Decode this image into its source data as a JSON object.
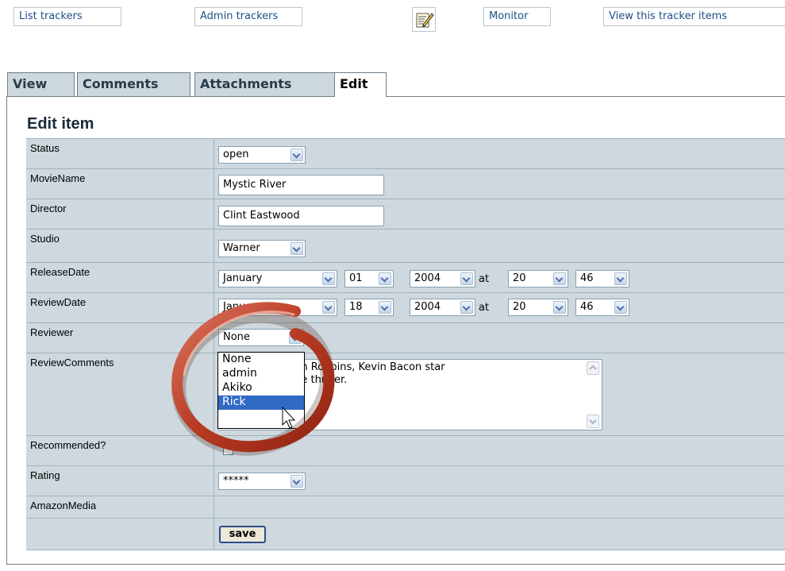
{
  "top_links": {
    "list_trackers": "List trackers",
    "admin_trackers": "Admin trackers",
    "monitor": "Monitor",
    "view_items": "View this tracker items"
  },
  "tabs": [
    "View",
    "Comments",
    "Attachments",
    "Edit"
  ],
  "active_tab": "Edit",
  "heading": "Edit item",
  "fields": {
    "status": {
      "label": "Status",
      "value": "open"
    },
    "movie_name": {
      "label": "MovieName",
      "value": "Mystic River"
    },
    "director": {
      "label": "Director",
      "value": "Clint Eastwood"
    },
    "studio": {
      "label": "Studio",
      "value": "Warner"
    },
    "release_date": {
      "label": "ReleaseDate",
      "month": "January",
      "day": "01",
      "year": "2004",
      "at": "at",
      "hour": "20",
      "minute": "46"
    },
    "review_date": {
      "label": "ReviewDate",
      "month": "January",
      "day": "18",
      "year": "2004",
      "at": "at",
      "hour": "20",
      "minute": "46"
    },
    "reviewer": {
      "label": "Reviewer",
      "value": "None",
      "options": [
        "None",
        "admin",
        "Akiko",
        "Rick"
      ],
      "highlighted": "Rick"
    },
    "review_comments": {
      "label": "ReviewComments",
      "line1": ", T n Robbins, Kevin Bacon star",
      "line2": "ed e thriller."
    },
    "recommended": {
      "label": "Recommended?"
    },
    "rating": {
      "label": "Rating",
      "value": "*****"
    },
    "amazon_media": {
      "label": "AmazonMedia"
    }
  },
  "save_label": "save",
  "colors": {
    "row_bg": "#ced8de",
    "tab_bg": "#cdd7de",
    "highlight": "#316ac5",
    "circle": "#c0442b"
  }
}
